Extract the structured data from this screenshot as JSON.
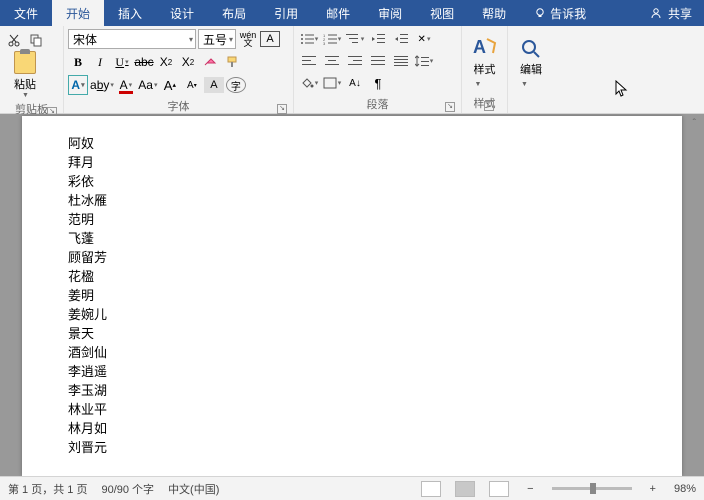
{
  "tabs": {
    "file": "文件",
    "home": "开始",
    "insert": "插入",
    "design": "设计",
    "layout": "布局",
    "references": "引用",
    "mailings": "邮件",
    "review": "审阅",
    "view": "视图",
    "help": "帮助",
    "tellme": "告诉我",
    "share": "共享"
  },
  "ribbon": {
    "clipboard": {
      "label": "剪贴板",
      "paste": "粘贴"
    },
    "font": {
      "label": "字体",
      "name": "宋体",
      "size": "五号",
      "wen": "wén"
    },
    "paragraph": {
      "label": "段落"
    },
    "styles": {
      "label": "样式",
      "btn": "样式"
    },
    "editing": {
      "label": "编辑",
      "btn": "编辑"
    }
  },
  "document": {
    "lines": [
      "阿奴",
      "拜月",
      "彩依",
      "杜冰雁",
      "范明",
      "飞蓬",
      "顾留芳",
      "花楹",
      "姜明",
      "姜婉儿",
      "景天",
      "酒剑仙",
      "李逍遥",
      "李玉湖",
      "林业平",
      "林月如",
      "刘晋元"
    ]
  },
  "status": {
    "page": "第 1 页，共 1 页",
    "words": "90/90 个字",
    "lang": "中文(中国)",
    "zoom": "98%"
  }
}
